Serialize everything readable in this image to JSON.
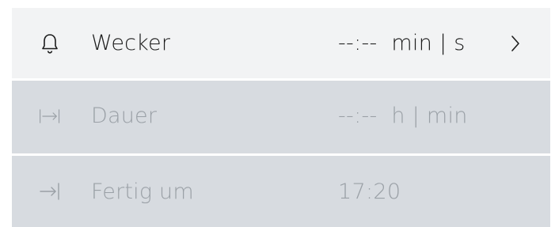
{
  "rows": [
    {
      "icon": "bell-icon",
      "label": "Wecker",
      "value": "--:--  min | s",
      "has_chevron": true,
      "enabled": true
    },
    {
      "icon": "duration-icon",
      "icon_text": "|→|",
      "label": "Dauer",
      "value": "--:--  h | min",
      "enabled": false
    },
    {
      "icon": "finish-time-icon",
      "icon_text": "→|",
      "label": "Fertig um",
      "value": "17:20",
      "enabled": false
    }
  ],
  "colors": {
    "active_row_bg": "#f2f3f4",
    "panel_bg": "#d7dbe0",
    "active_text": "#1c1c1c",
    "disabled_text": "#9aa0a6",
    "separator": "#ffffff"
  }
}
